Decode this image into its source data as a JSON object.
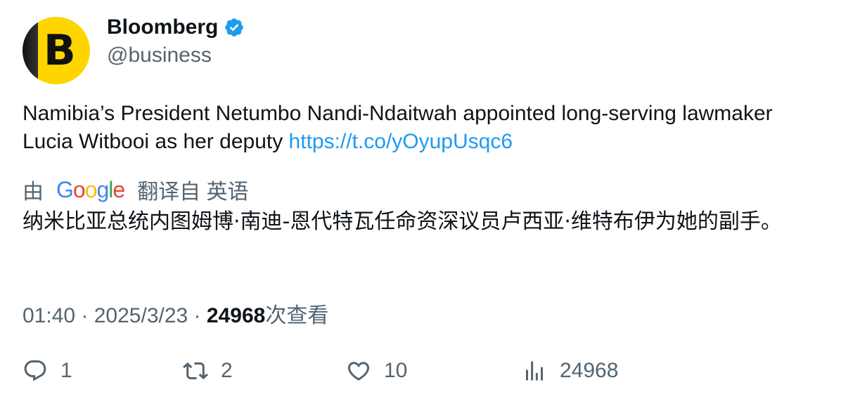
{
  "author": {
    "avatar_letter": "B",
    "name": "Bloomberg",
    "handle": "@business"
  },
  "tweet": {
    "text": "Namibia’s President Netumbo Nandi-Ndaitwah appointed long-serving lawmaker Lucia Witbooi as her deputy ",
    "link": "https://t.co/yOyupUsqc6"
  },
  "translation": {
    "prefix": "由",
    "provider": "Google",
    "suffix": "翻译自 英语",
    "text": "纳米比亚总统内图姆博·南迪-恩代特瓦任命资深议员卢西亚·维特布伊为她的副手。"
  },
  "meta": {
    "time": "01:40",
    "separator": " · ",
    "date": "2025/3/23",
    "views": "24968",
    "views_label": "次查看"
  },
  "actions": {
    "replies": "1",
    "retweets": "2",
    "likes": "10",
    "views": "24968"
  },
  "colors": {
    "accent": "#1d9bf0",
    "secondary": "#536471",
    "avatar_bg": "#ffd500"
  }
}
